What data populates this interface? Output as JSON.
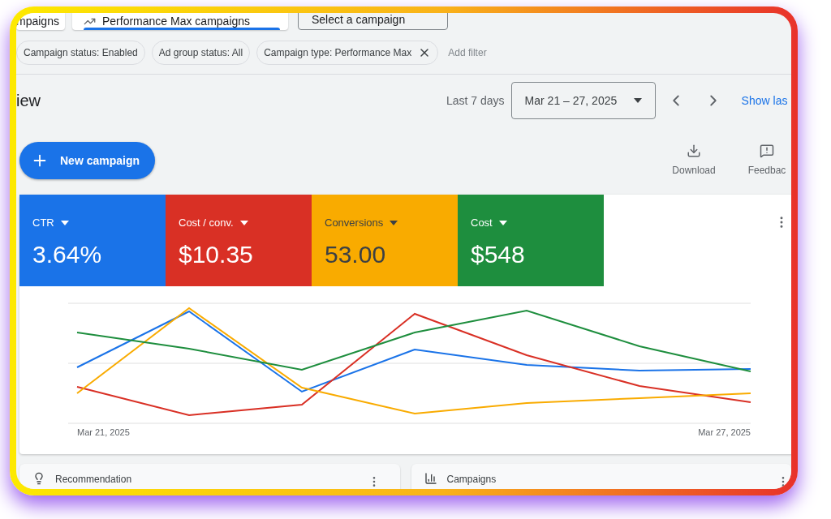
{
  "tabs": [
    {
      "label": "mpaigns",
      "icon": false,
      "selected": false
    },
    {
      "label": "Performance Max campaigns",
      "icon": true,
      "selected": true
    }
  ],
  "campaign_select": {
    "value": "Select a campaign"
  },
  "filters": [
    {
      "label": "Campaign status: Enabled",
      "removable": false
    },
    {
      "label": "Ad group status: All",
      "removable": false
    },
    {
      "label": "Campaign type: Performance Max",
      "removable": true
    }
  ],
  "add_filter": "Add filter",
  "page_title": "iew",
  "date_range": {
    "label": "Last 7 days",
    "value": "Mar 21 – 27, 2025",
    "show_link": "Show las"
  },
  "new_campaign": "New campaign",
  "actions": [
    {
      "kind": "download",
      "label": "Download"
    },
    {
      "kind": "feedback",
      "label": "Feedbac"
    }
  ],
  "metrics": [
    {
      "name": "CTR",
      "value": "3.64%",
      "color": "#1a73e8",
      "dark_text": false
    },
    {
      "name": "Cost / conv.",
      "value": "$10.35",
      "color": "#d93025",
      "dark_text": false
    },
    {
      "name": "Conversions",
      "value": "53.00",
      "color": "#f9ab00",
      "dark_text": true
    },
    {
      "name": "Cost",
      "value": "$548",
      "color": "#1e8e3e",
      "dark_text": false
    }
  ],
  "chart_axis": {
    "start": "Mar 21, 2025",
    "end": "Mar 27, 2025"
  },
  "bottom_cards": [
    {
      "kind": "recommendation",
      "title": "Recommendation"
    },
    {
      "kind": "campaigns",
      "title": "Campaigns"
    }
  ]
}
